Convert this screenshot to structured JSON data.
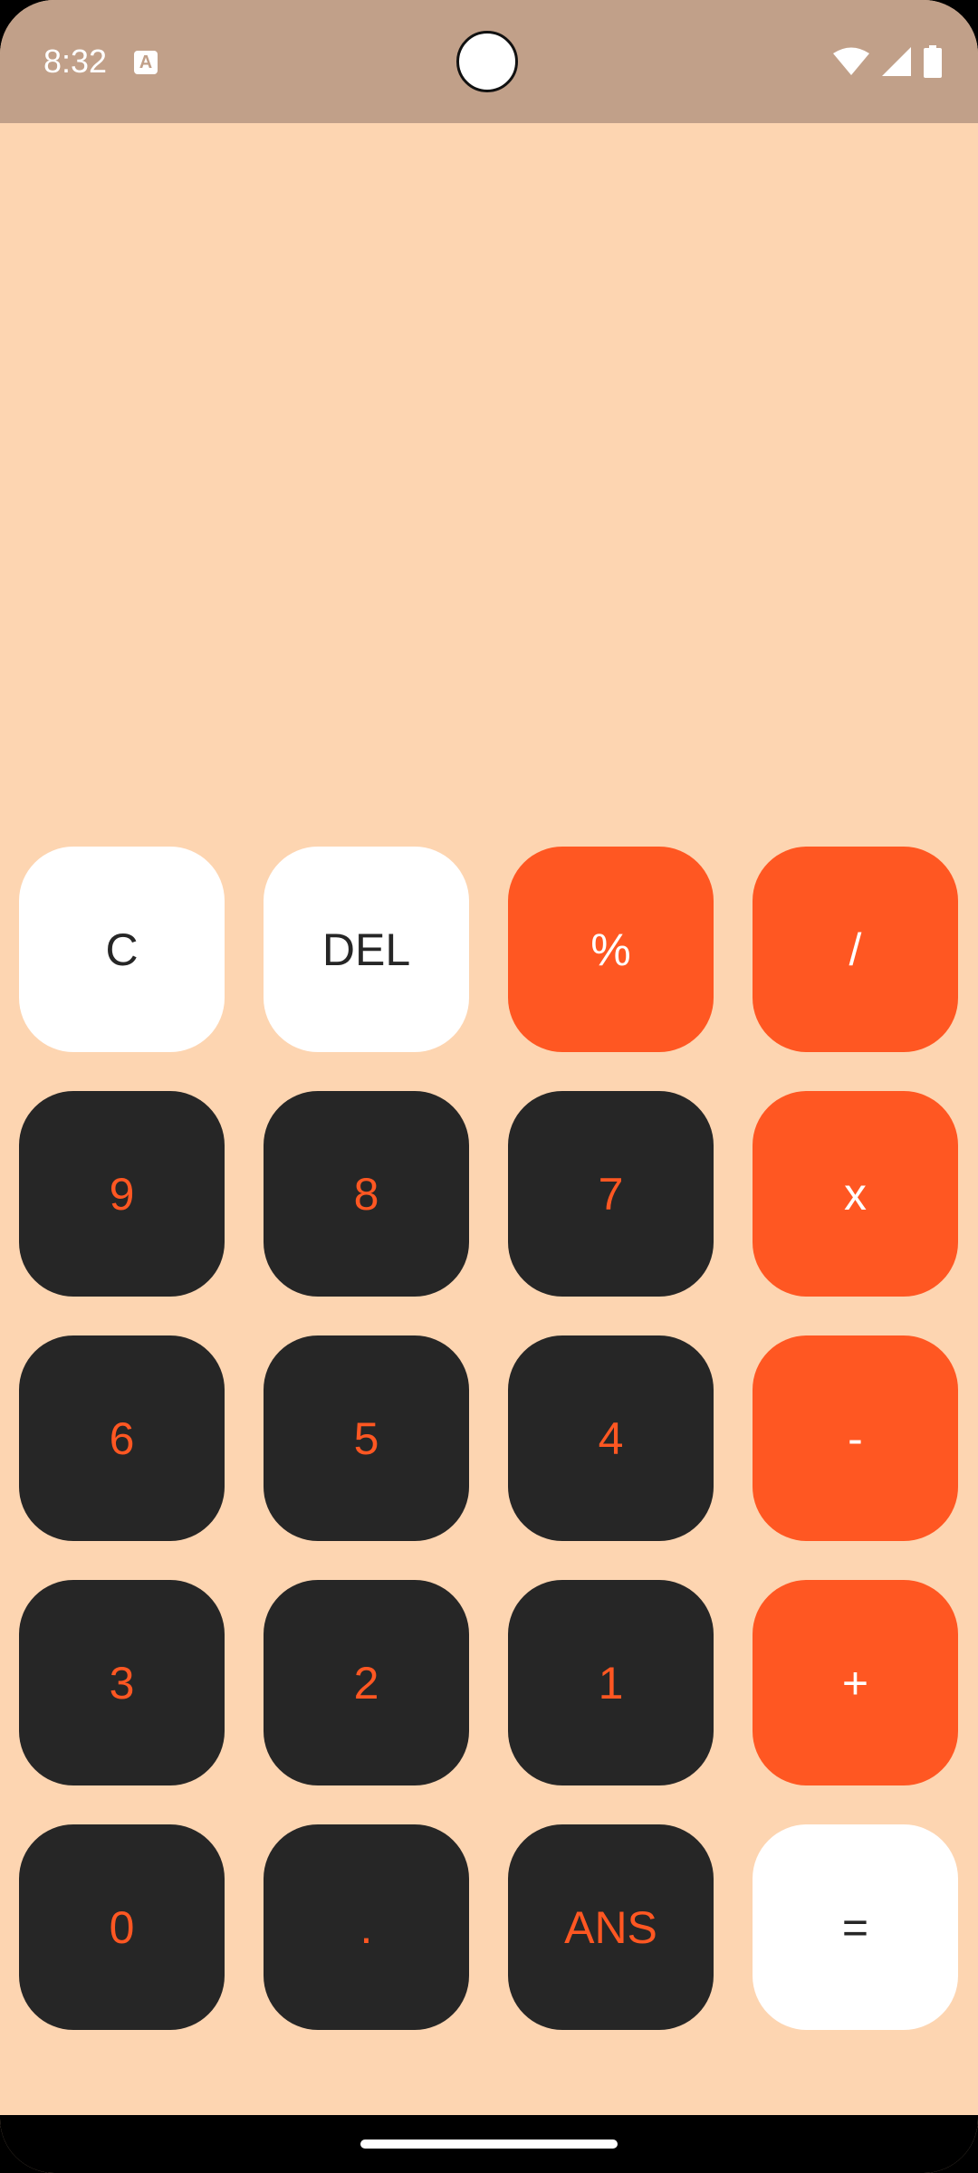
{
  "status_bar": {
    "time": "8:32",
    "notification_icon": "text-a-icon",
    "icons": [
      "wifi-icon",
      "cell-signal-icon",
      "battery-icon"
    ]
  },
  "display": {
    "expression": "",
    "result": ""
  },
  "keypad": {
    "keys": [
      {
        "label": "C",
        "style": "light"
      },
      {
        "label": "DEL",
        "style": "light"
      },
      {
        "label": "%",
        "style": "orange"
      },
      {
        "label": "/",
        "style": "orange"
      },
      {
        "label": "9",
        "style": "dark"
      },
      {
        "label": "8",
        "style": "dark"
      },
      {
        "label": "7",
        "style": "dark"
      },
      {
        "label": "x",
        "style": "orange"
      },
      {
        "label": "6",
        "style": "dark"
      },
      {
        "label": "5",
        "style": "dark"
      },
      {
        "label": "4",
        "style": "dark"
      },
      {
        "label": "-",
        "style": "orange"
      },
      {
        "label": "3",
        "style": "dark"
      },
      {
        "label": "2",
        "style": "dark"
      },
      {
        "label": "1",
        "style": "dark"
      },
      {
        "label": "+",
        "style": "orange"
      },
      {
        "label": "0",
        "style": "dark"
      },
      {
        "label": ".",
        "style": "dark"
      },
      {
        "label": "ANS",
        "style": "dark"
      },
      {
        "label": "=",
        "style": "light"
      }
    ]
  },
  "colors": {
    "background": "#FDD5B1",
    "status_bar": "#C1A089",
    "accent": "#FF5722",
    "dark_key": "#262626",
    "light_key": "#FFFFFF"
  }
}
